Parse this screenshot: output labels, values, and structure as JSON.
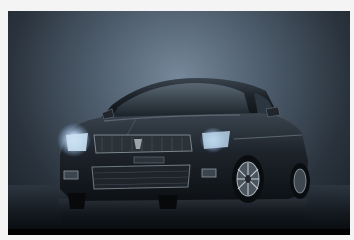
{
  "image": {
    "subject": "car-photo",
    "colors": {
      "background_light": "#76889a",
      "background_dark": "#171d24",
      "car_body": "#1b2026",
      "headlight": "#e8f4ff"
    }
  }
}
